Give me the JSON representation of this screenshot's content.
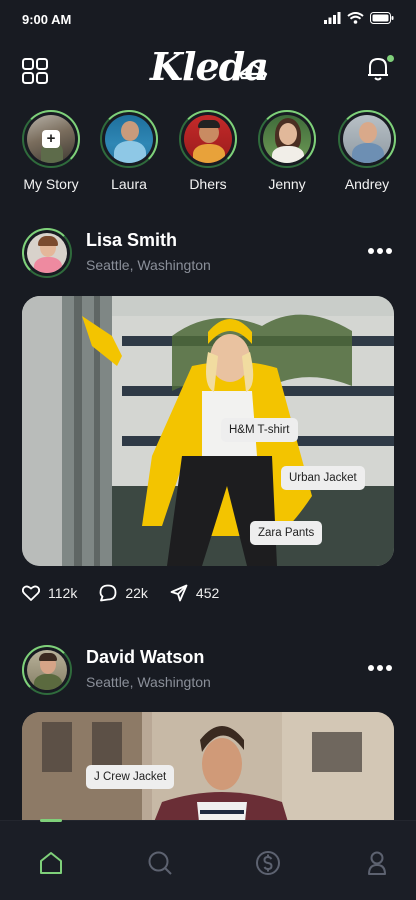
{
  "status_bar": {
    "time": "9:00 AM"
  },
  "header": {
    "logo": "Kleda"
  },
  "stories": [
    {
      "name": "My Story",
      "is_own": true
    },
    {
      "name": "Laura"
    },
    {
      "name": "Dhers"
    },
    {
      "name": "Jenny"
    },
    {
      "name": "Andrey"
    }
  ],
  "posts": [
    {
      "author": "Lisa Smith",
      "location": "Seattle, Washington",
      "tags": [
        "H&M T-shirt",
        "Urban Jacket",
        "Zara Pants"
      ],
      "likes": "112k",
      "comments": "22k",
      "shares": "452"
    },
    {
      "author": "David Watson",
      "location": "Seattle, Washington",
      "tags": [
        "J Crew Jacket"
      ]
    }
  ],
  "colors": {
    "background": "#181b22",
    "accent": "#7fd07a",
    "tag_bg": "#eeeeee"
  },
  "tabbar": {
    "items": [
      "home-icon",
      "search-icon",
      "dollar-icon",
      "profile-icon"
    ],
    "active": "home-icon"
  }
}
